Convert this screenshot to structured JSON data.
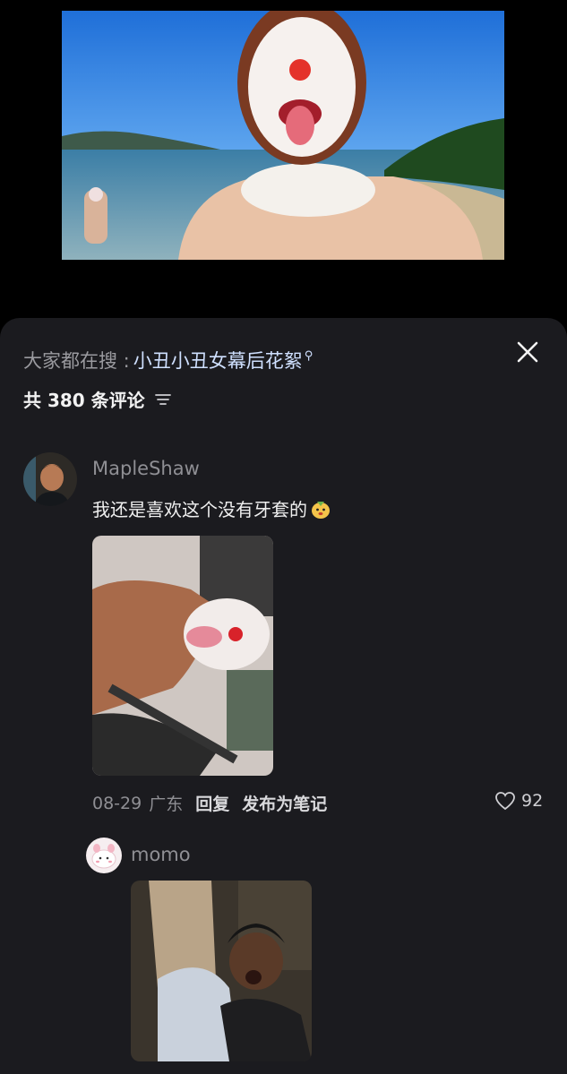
{
  "search": {
    "prefix": "大家都在搜 : ",
    "keyword": "小丑小丑女幕后花絮"
  },
  "comments_header": {
    "count_text": "共 380 条评论"
  },
  "comments": [
    {
      "username": "MapleShaw",
      "text": "我还是喜欢这个没有牙套的",
      "date": "08-29",
      "location": "广东",
      "reply_label": "回复",
      "note_label": "发布为笔记",
      "likes": "92"
    },
    {
      "username": "momo"
    }
  ],
  "colors": {
    "sheet_bg": "#1b1b1f",
    "keyword": "#cfe0ff",
    "muted": "#8f8f94"
  },
  "icons": [
    "close-icon",
    "sort-icon",
    "heart-icon",
    "search-icon",
    "emoji-icon"
  ]
}
